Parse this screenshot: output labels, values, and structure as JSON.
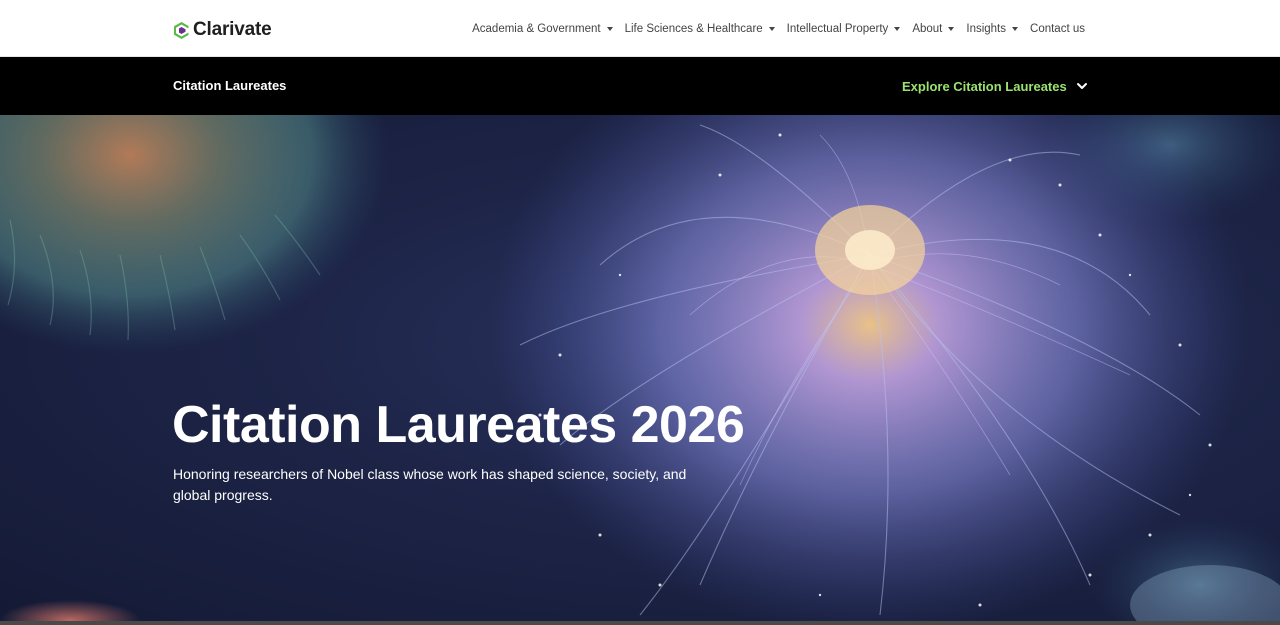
{
  "brand": {
    "name": "Clarivate",
    "colors": {
      "logo_green": "#5bb94b",
      "logo_purple": "#6b2f8e",
      "accent_green": "#9be36f",
      "sub_header_bg": "#000000"
    }
  },
  "nav": {
    "items": [
      {
        "label": "Academia & Government",
        "has_dropdown": true
      },
      {
        "label": "Life Sciences & Healthcare",
        "has_dropdown": true
      },
      {
        "label": "Intellectual Property",
        "has_dropdown": true
      },
      {
        "label": "About",
        "has_dropdown": true
      },
      {
        "label": "Insights",
        "has_dropdown": true
      },
      {
        "label": "Contact us",
        "has_dropdown": false
      }
    ]
  },
  "sub_header": {
    "title": "Citation Laureates",
    "explore_label": "Explore Citation Laureates",
    "explore_icon": "chevron-down-icon"
  },
  "hero": {
    "title": "Citation Laureates 2026",
    "subtitle": "Honoring researchers of Nobel class whose work has shaped science, society, and global progress.",
    "image": "bioluminescent-jellyfish-flower-illustration"
  }
}
